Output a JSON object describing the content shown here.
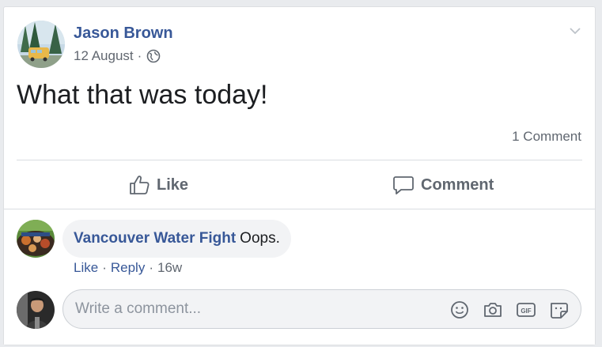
{
  "post": {
    "author": "Jason Brown",
    "date": "12 August",
    "separator": "·",
    "privacy_icon": "globe-icon",
    "text": "What that was today!",
    "comment_count": "1 Comment"
  },
  "actions": {
    "like_label": "Like",
    "comment_label": "Comment"
  },
  "comments": [
    {
      "author": "Vancouver Water Fight",
      "text": "Oops.",
      "like_label": "Like",
      "reply_label": "Reply",
      "separator": "·",
      "age": "16w"
    }
  ],
  "composer": {
    "placeholder": "Write a comment...",
    "icons": [
      "emoji-icon",
      "camera-icon",
      "gif-icon",
      "sticker-icon"
    ]
  },
  "colors": {
    "link": "#385898",
    "muted": "#606770",
    "bubble": "#f2f3f5",
    "background": "#e9ebee"
  }
}
